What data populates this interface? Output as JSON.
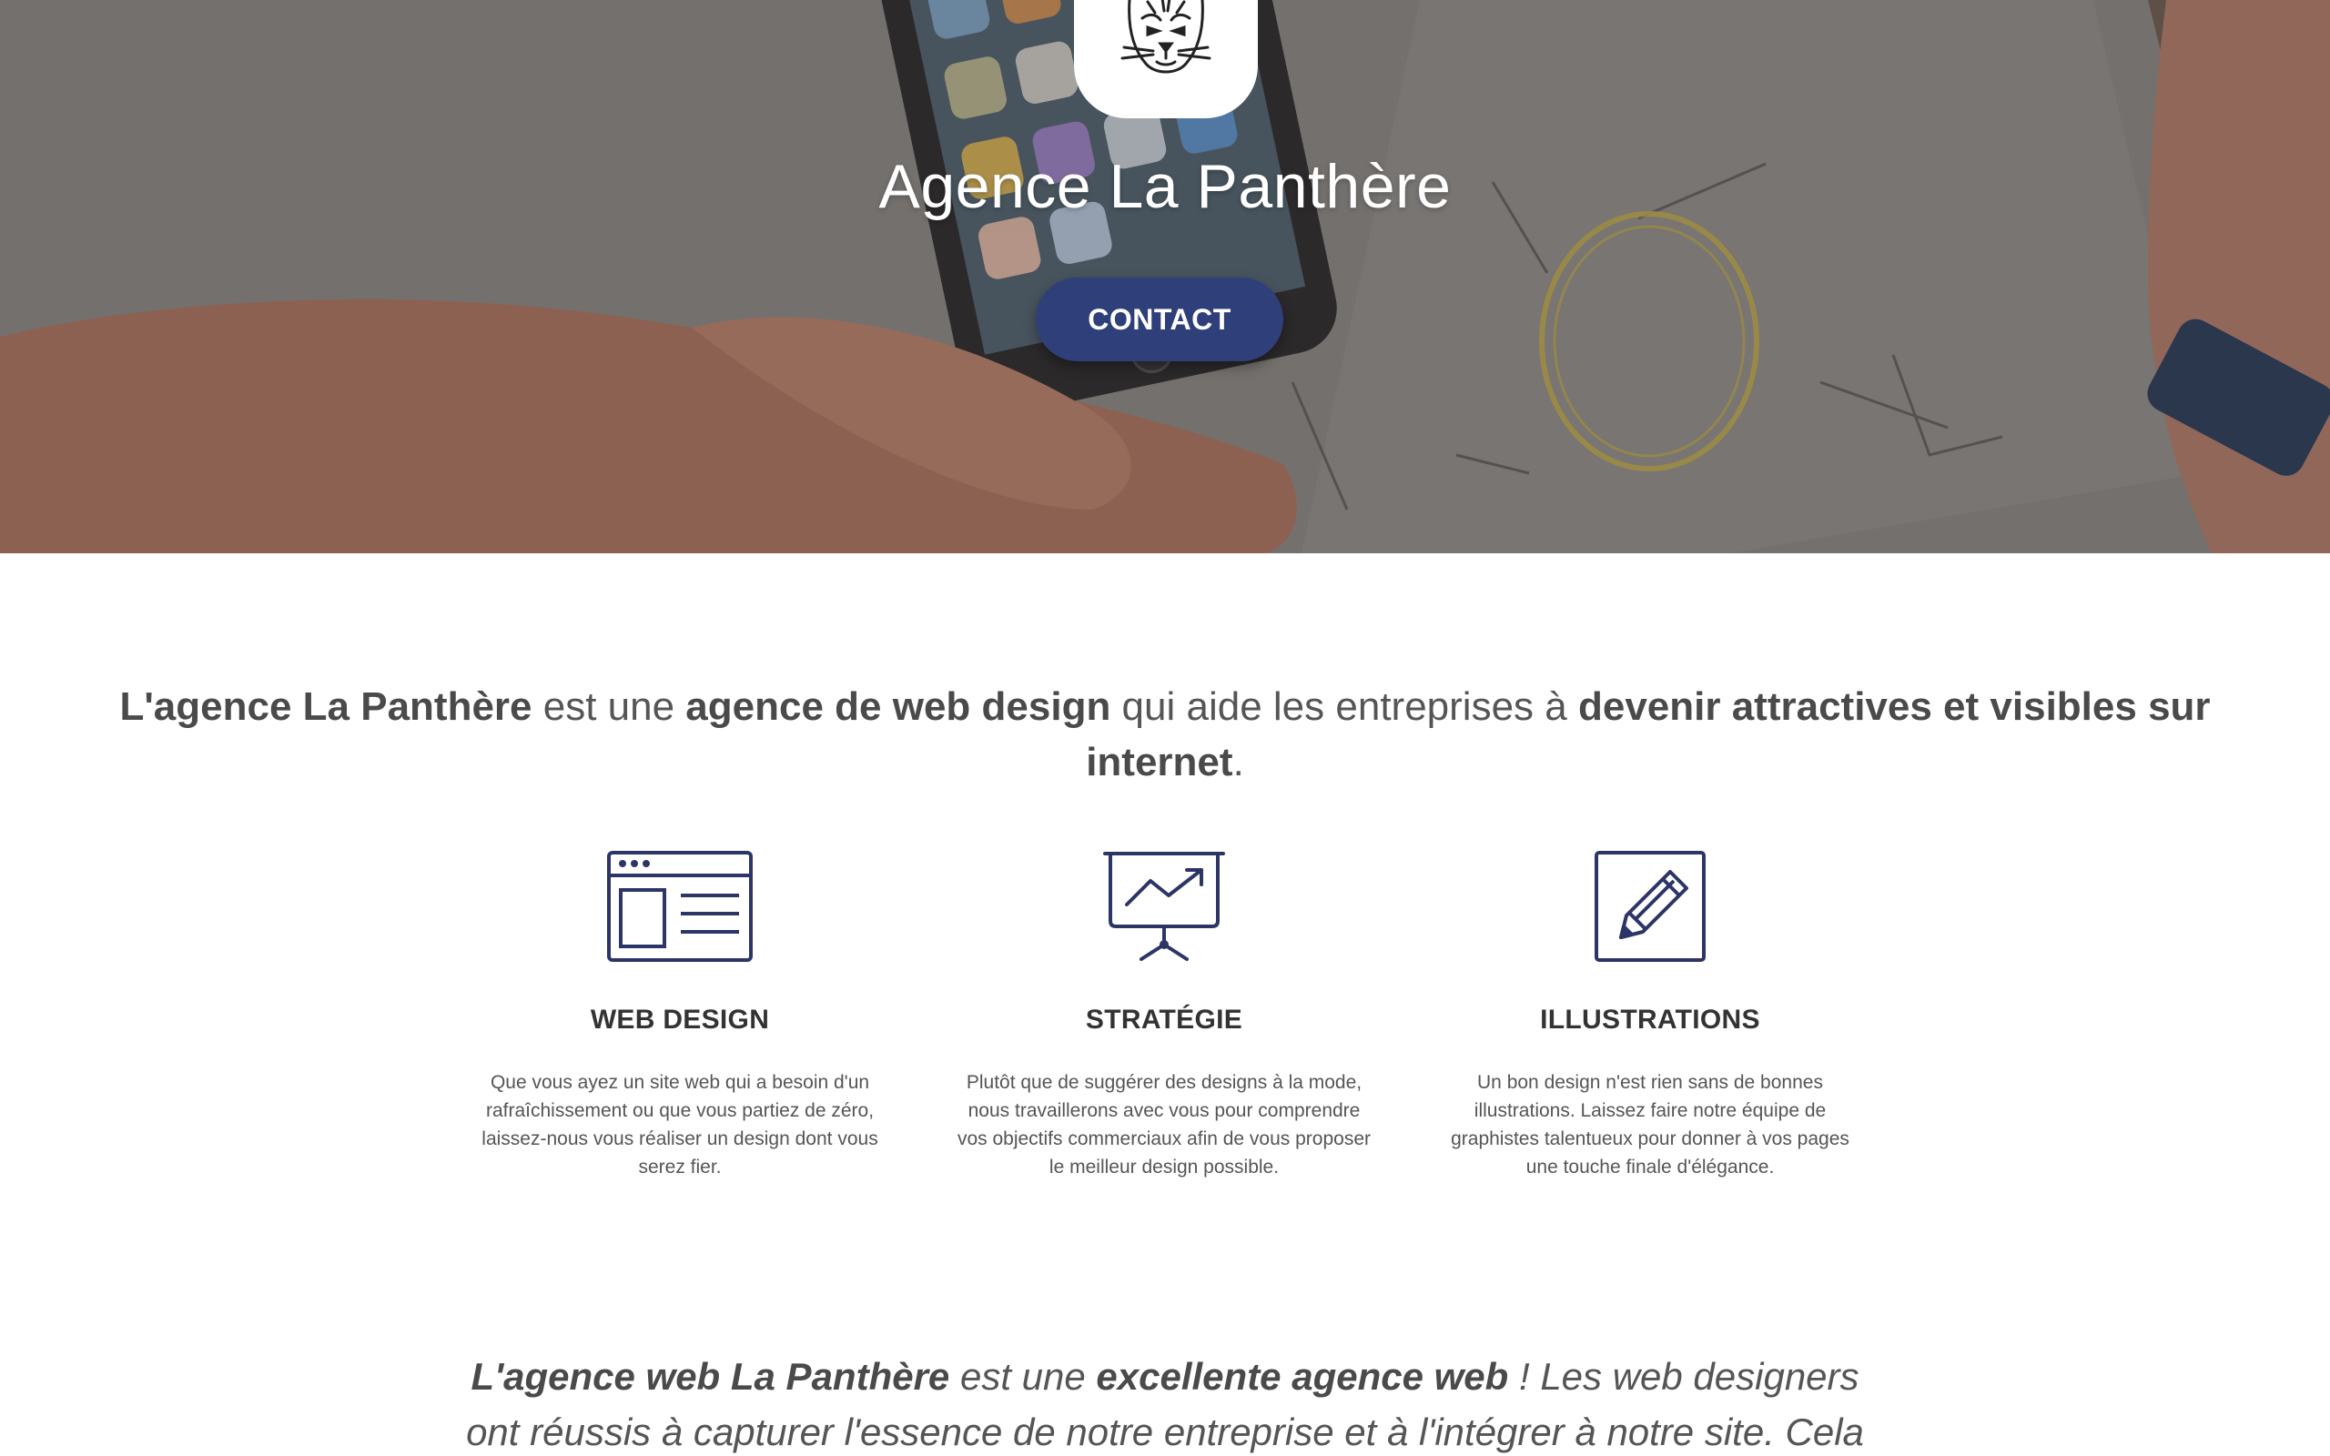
{
  "hero": {
    "title": "Agence La Panthère",
    "contact_label": "CONTACT",
    "logo_icon": "panther-head-icon"
  },
  "intro": {
    "part1_bold": "L'agence La Panthère",
    "part2": " est une ",
    "part3_bold": "agence de web design",
    "part4": " qui aide les entreprises à ",
    "part5_bold": "devenir attractives et visibles sur internet",
    "part6": "."
  },
  "services": [
    {
      "icon": "browser-window-icon",
      "title": "WEB DESIGN",
      "text": "Que vous ayez un site web qui a besoin d'un rafraîchissement ou que vous partiez de zéro, laissez-nous vous réaliser un design dont vous serez fier."
    },
    {
      "icon": "presentation-chart-icon",
      "title": "STRATÉGIE",
      "text": "Plutôt que de suggérer des designs à la mode, nous travaillerons avec vous pour comprendre vos objectifs commerciaux afin de vous proposer le meilleur design possible."
    },
    {
      "icon": "pencil-square-icon",
      "title": "ILLUSTRATIONS",
      "text": "Un bon design n'est rien sans de bonnes illustrations. Laissez faire notre équipe de graphistes talentueux pour donner à vos pages une touche finale d'élégance."
    }
  ],
  "testimonial": {
    "part1_bold": "L'agence web La Panthère",
    "part2": " est une ",
    "part3_bold": "excellente agence web",
    "part4": " ! Les web designers ont réussis à capturer l'essence de notre entreprise et à l'intégrer à notre site. Cela"
  },
  "colors": {
    "accent": "#2f3f7a",
    "icon_stroke": "#2c3566",
    "text": "#555555",
    "heading": "#333333"
  }
}
